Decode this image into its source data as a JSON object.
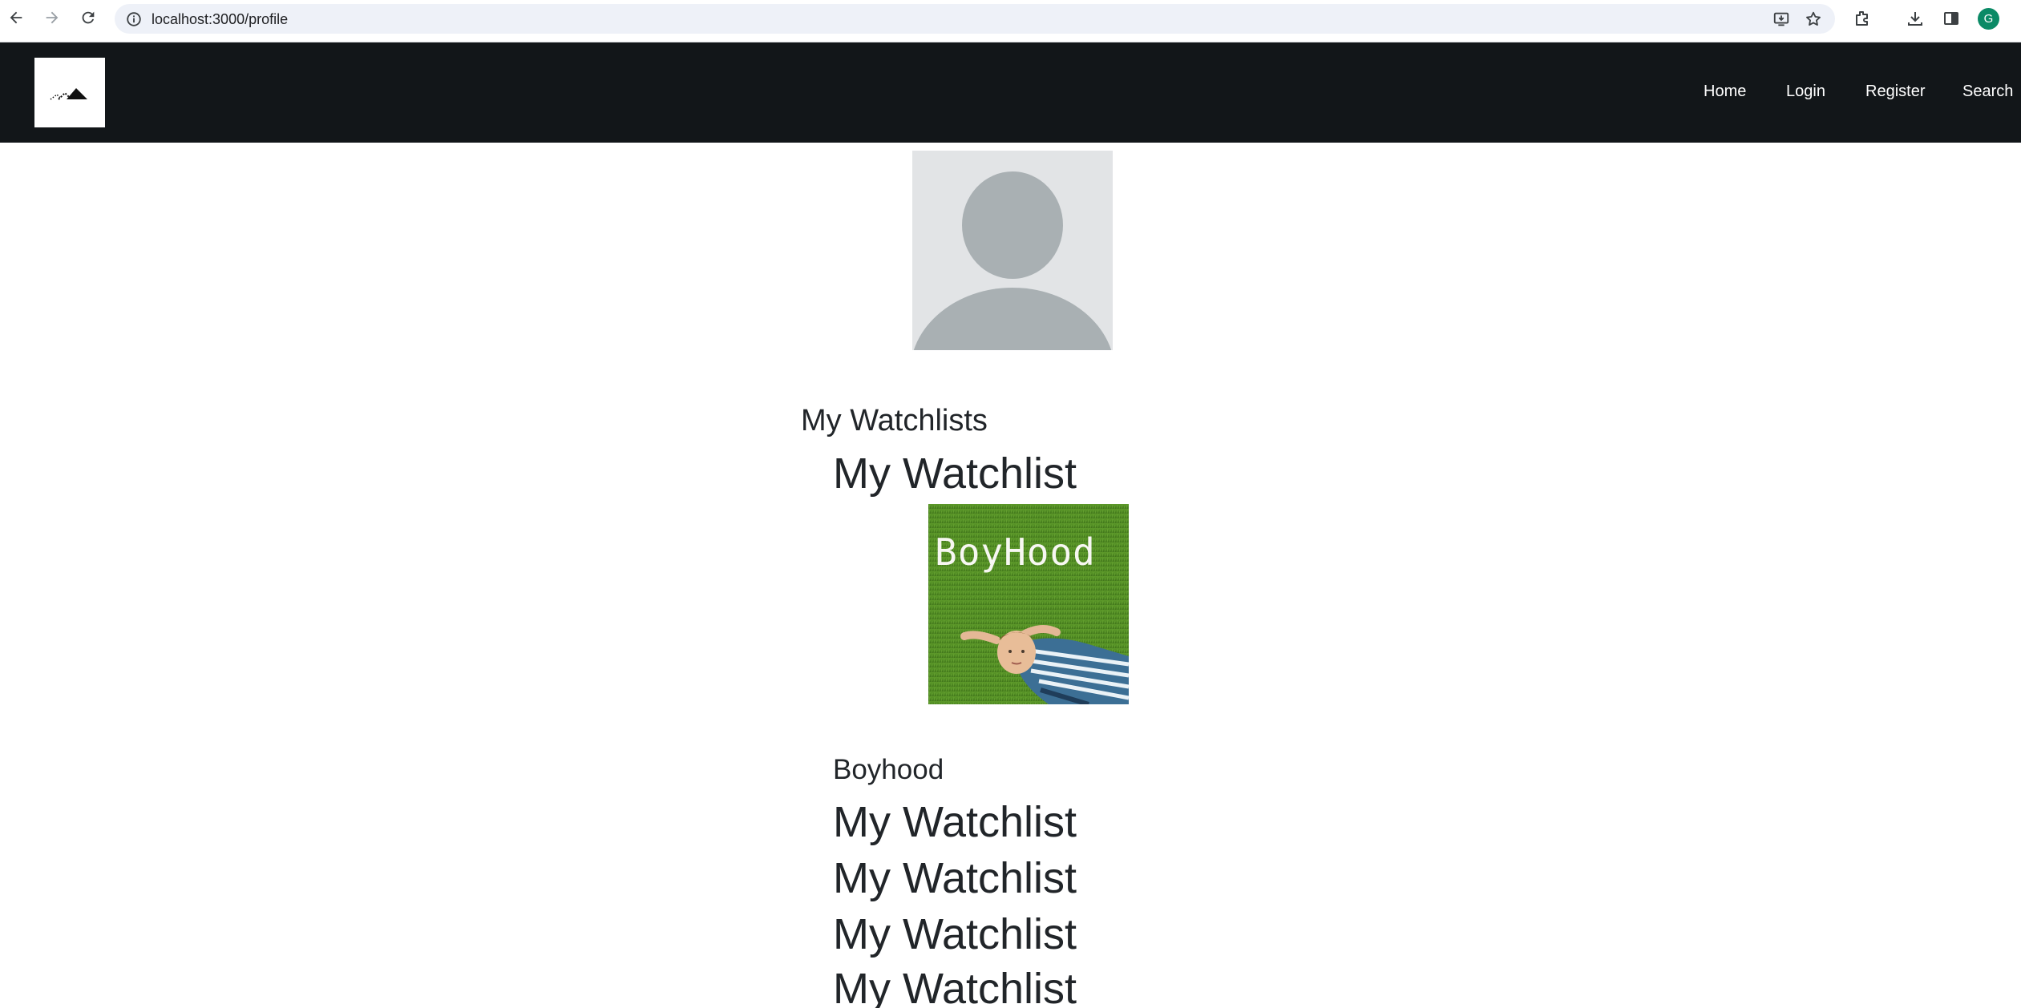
{
  "browser": {
    "url": "localhost:3000/profile",
    "profile_initial": "G",
    "profile_color": "#0b8a66"
  },
  "navbar": {
    "background": "#121619",
    "links": [
      "Home",
      "Login",
      "Register",
      "Search"
    ]
  },
  "profile": {
    "avatar_icon": "default-user-silhouette-icon",
    "section_title": "My Watchlists"
  },
  "watchlists": [
    {
      "title": "My Watchlist",
      "movies": [
        {
          "title": "Boyhood",
          "poster_text": "BoyHood"
        }
      ]
    },
    {
      "title": "My Watchlist",
      "movies": []
    },
    {
      "title": "My Watchlist",
      "movies": []
    },
    {
      "title": "My Watchlist",
      "movies": []
    },
    {
      "title": "My Watchlist",
      "movies": []
    }
  ]
}
